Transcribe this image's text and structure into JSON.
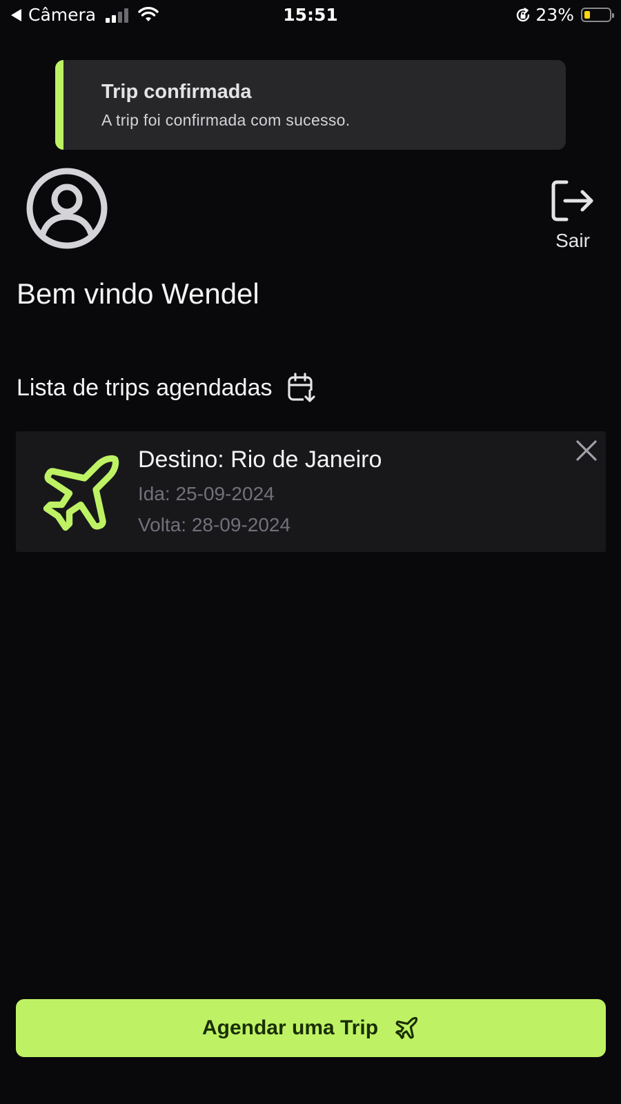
{
  "status_bar": {
    "back_label": "Câmera",
    "time": "15:51",
    "battery": "23%",
    "battery_level": 0.23,
    "battery_color": "#ffd60a"
  },
  "toast": {
    "title": "Trip confirmada",
    "message": "A trip foi confirmada com sucesso.",
    "accent_color": "#bef264"
  },
  "header": {
    "avatar_icon": "user-circle-icon",
    "logout_icon": "logout-icon",
    "logout_label": "Sair"
  },
  "welcome": "Bem vindo Wendel",
  "trips_section": {
    "title": "Lista de trips agendadas",
    "icon": "calendar-arrow-down-icon"
  },
  "trips": [
    {
      "destination": "Destino: Rio de Janeiro",
      "departure": "Ida: 25-09-2024",
      "return": "Volta: 28-09-2024",
      "icon": "airplane-icon"
    }
  ],
  "schedule_button": {
    "label": "Agendar uma Trip",
    "icon": "airplane-icon"
  },
  "colors": {
    "background": "#09090b",
    "accent": "#bef264",
    "card": "#18181b",
    "toast": "#27272a",
    "muted_text": "#71717a"
  }
}
